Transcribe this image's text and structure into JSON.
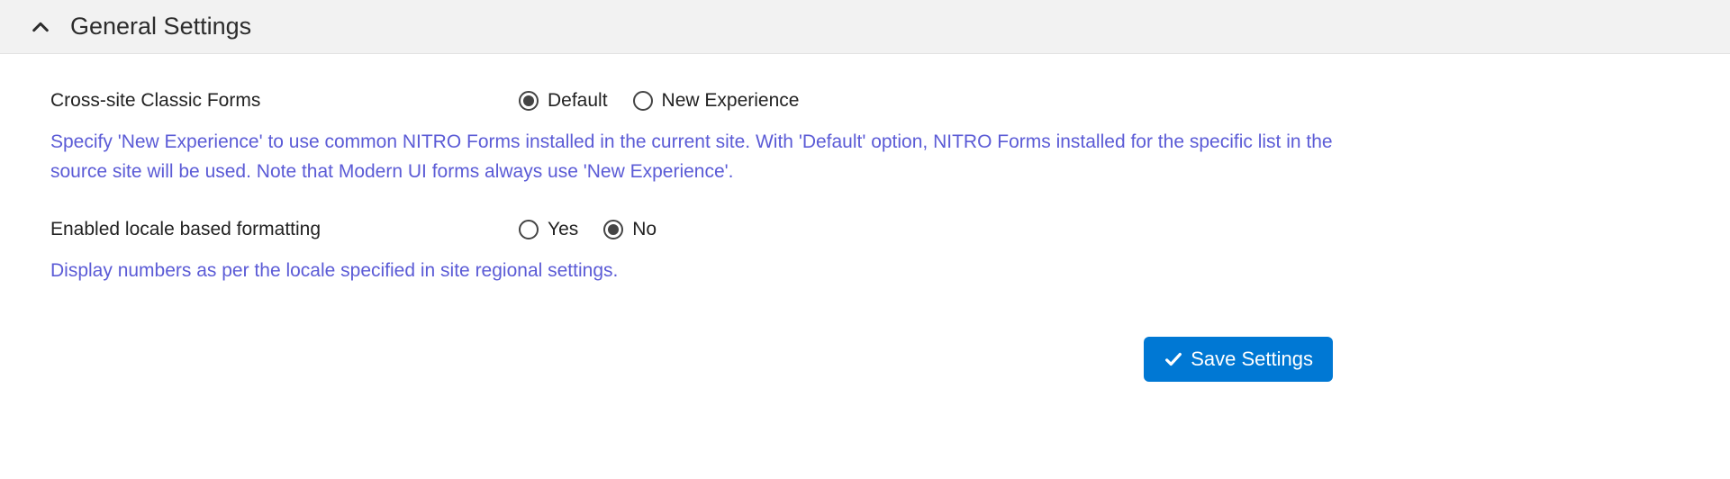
{
  "header": {
    "title": "General Settings"
  },
  "settings": {
    "crossSite": {
      "label": "Cross-site Classic Forms",
      "options": {
        "default": "Default",
        "newExp": "New Experience"
      },
      "selected": "default",
      "help": "Specify 'New Experience' to use common NITRO Forms installed in the current site. With 'Default' option, NITRO Forms installed for the specific list in the source site will be used. Note that Modern UI forms always use 'New Experience'."
    },
    "localeFormatting": {
      "label": "Enabled locale based formatting",
      "options": {
        "yes": "Yes",
        "no": "No"
      },
      "selected": "no",
      "help": "Display numbers as per the locale specified in site regional settings."
    }
  },
  "actions": {
    "save": "Save Settings"
  }
}
